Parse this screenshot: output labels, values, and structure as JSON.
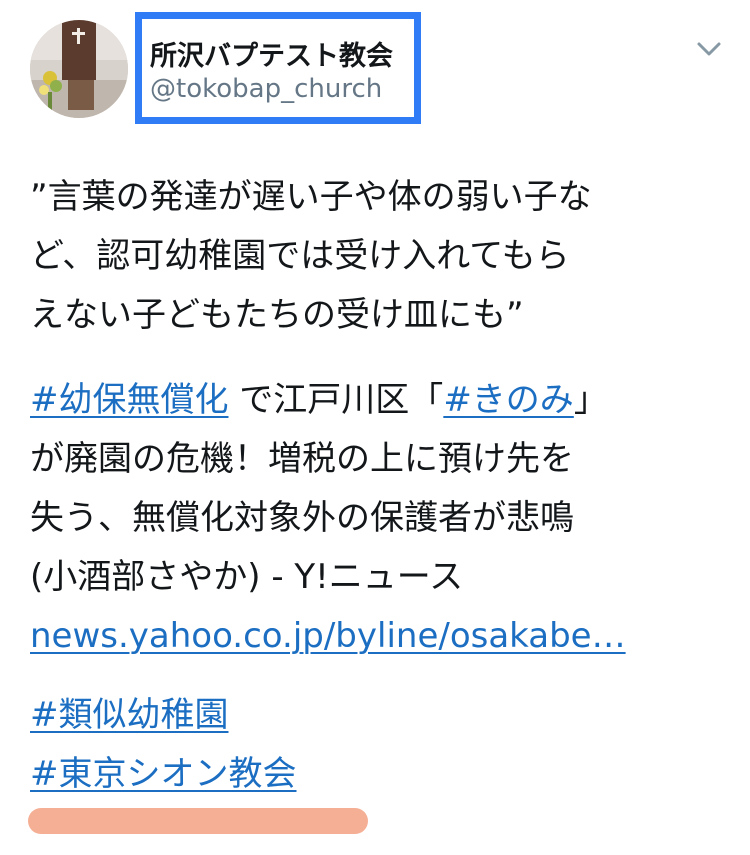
{
  "account": {
    "display_name": "所沢バプテスト教会",
    "handle": "@tokobap_church",
    "highlight_color": "#2f7cf6"
  },
  "menu": {
    "icon": "chevron-down-icon"
  },
  "tweet": {
    "quote_lines": [
      "”言葉の発達が遅い子や体の弱い子な",
      "ど、認可幼稚園では受け入れてもら",
      "えない子どもたちの受け皿にも”"
    ],
    "hashtag_mushoka": "#幼保無償化",
    "text_after_tag1": " で江戸川区「",
    "hashtag_kinomi": "#きのみ",
    "text_after_tag2": "」",
    "body_lines": [
      "が廃園の危機！増税の上に預け先を",
      "失う、無償化対象外の保護者が悲鳴",
      "(小酒部さやか) - Y!ニュース"
    ],
    "link": "news.yahoo.co.jp/byline/osakabe…",
    "hashtag_ruiji": "#類似幼稚園",
    "hashtag_zion": "#東京シオン教会",
    "link_color": "#1b6ec2",
    "marker_color": "#f3a183"
  }
}
